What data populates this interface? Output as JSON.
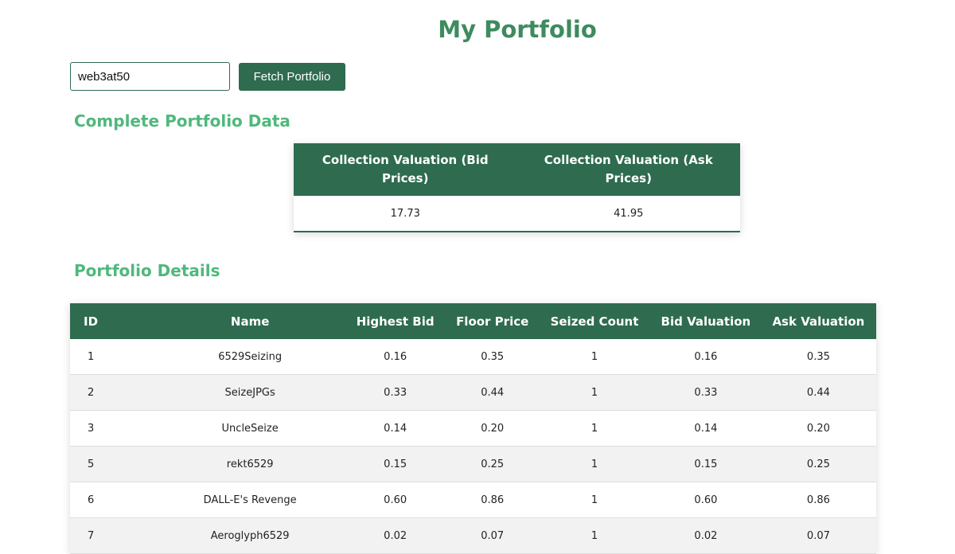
{
  "page": {
    "title": "My Portfolio"
  },
  "search": {
    "value": "web3at50",
    "button_label": "Fetch Portfolio"
  },
  "summary": {
    "heading": "Complete Portfolio Data",
    "headers": [
      "Collection Valuation (Bid Prices)",
      "Collection Valuation (Ask Prices)"
    ],
    "values": [
      "17.73",
      "41.95"
    ]
  },
  "details": {
    "heading": "Portfolio Details",
    "headers": [
      "ID",
      "Name",
      "Highest Bid",
      "Floor Price",
      "Seized Count",
      "Bid Valuation",
      "Ask Valuation"
    ],
    "rows": [
      [
        "1",
        "6529Seizing",
        "0.16",
        "0.35",
        "1",
        "0.16",
        "0.35"
      ],
      [
        "2",
        "SeizeJPGs",
        "0.33",
        "0.44",
        "1",
        "0.33",
        "0.44"
      ],
      [
        "3",
        "UncleSeize",
        "0.14",
        "0.20",
        "1",
        "0.14",
        "0.20"
      ],
      [
        "5",
        "rekt6529",
        "0.15",
        "0.25",
        "1",
        "0.15",
        "0.25"
      ],
      [
        "6",
        "DALL-E's Revenge",
        "0.60",
        "0.86",
        "1",
        "0.60",
        "0.86"
      ],
      [
        "7",
        "Aeroglyph6529",
        "0.02",
        "0.07",
        "1",
        "0.02",
        "0.07"
      ]
    ]
  },
  "colors": {
    "primary": "#2e6b4f",
    "title": "#3d8b5f",
    "section_heading": "#4fb87c",
    "row_alt": "#f2f2f2"
  }
}
